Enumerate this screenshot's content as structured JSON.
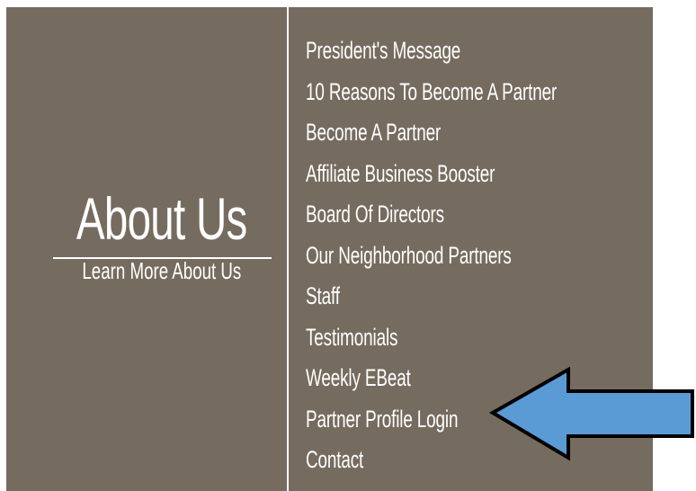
{
  "about": {
    "title": "About Us",
    "subtitle": "Learn More About Us"
  },
  "menu": {
    "items": [
      {
        "label": "President's Message"
      },
      {
        "label": "10 Reasons To Become A Partner"
      },
      {
        "label": "Become A Partner"
      },
      {
        "label": "Affiliate Business Booster"
      },
      {
        "label": "Board Of Directors"
      },
      {
        "label": "Our Neighborhood Partners"
      },
      {
        "label": "Staff"
      },
      {
        "label": "Testimonials"
      },
      {
        "label": "Weekly EBeat"
      },
      {
        "label": "Partner Profile Login"
      },
      {
        "label": "Contact"
      }
    ]
  },
  "colors": {
    "panel_bg": "#756b5f",
    "text": "#ffffff",
    "arrow_fill": "#5b9bd5",
    "arrow_stroke": "#000000"
  },
  "annotation": {
    "icon": "left-arrow-icon",
    "points_to": "Partner Profile Login"
  }
}
